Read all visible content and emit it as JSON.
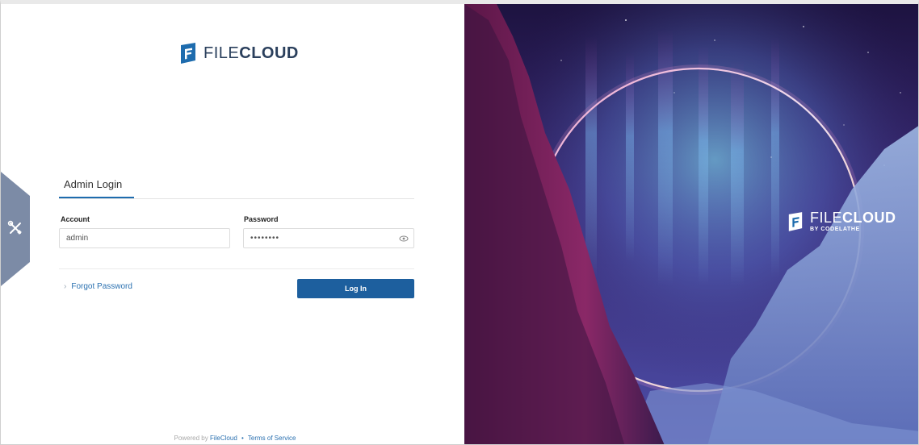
{
  "brand": {
    "name_light": "FILE",
    "name_bold": "CLOUD",
    "tagline": "BY CODELATHE"
  },
  "icons": {
    "logo": "filecloud-logo-icon",
    "tools": "tools-icon",
    "eye": "show-password-icon",
    "chevron": "chevron-right-icon"
  },
  "login": {
    "tab_label": "Admin Login",
    "account_label": "Account",
    "account_value": "admin",
    "password_label": "Password",
    "password_value": "••••••••",
    "forgot_chevron": "›",
    "forgot_label": "Forgot Password",
    "submit_label": "Log In"
  },
  "footer": {
    "powered_by": "Powered by",
    "filecloud_link": "FileCloud",
    "separator": "•",
    "terms_link": "Terms of Service"
  },
  "colors": {
    "primary": "#1d5f9e",
    "link": "#2a70b0",
    "logo_blue": "#1e6cae",
    "side_tab": "#7c8ba6"
  }
}
